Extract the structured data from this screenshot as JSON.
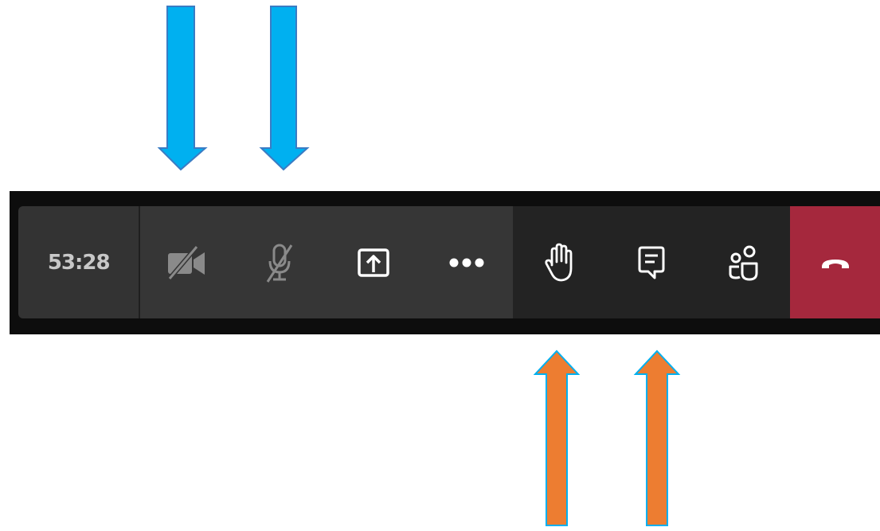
{
  "meeting_toolbar": {
    "timer": "53:28",
    "buttons": [
      {
        "name": "camera-off",
        "icon": "camera-off-icon",
        "state": "off"
      },
      {
        "name": "mic-muted",
        "icon": "mic-off-icon",
        "state": "muted"
      },
      {
        "name": "share-screen",
        "icon": "share-tray-icon"
      },
      {
        "name": "more-actions",
        "icon": "more-dots-icon"
      },
      {
        "name": "raise-hand",
        "icon": "raise-hand-icon"
      },
      {
        "name": "show-conversation",
        "icon": "chat-icon"
      },
      {
        "name": "show-participants",
        "icon": "participants-icon"
      },
      {
        "name": "leave-call",
        "icon": "hang-up-icon"
      }
    ]
  },
  "annotations": {
    "top_arrows": {
      "color": "#00b0f0",
      "direction": "down",
      "count": 2
    },
    "bottom_arrows": {
      "color": "#ed7d31",
      "outline": "#00b0f0",
      "direction": "up",
      "count": 2
    }
  },
  "colors": {
    "toolbar_bg": "#363636",
    "toolbar_dark": "#232323",
    "leave_red": "#a5283d",
    "icon_dim": "#8a8a8a",
    "icon_white": "#ffffff"
  }
}
